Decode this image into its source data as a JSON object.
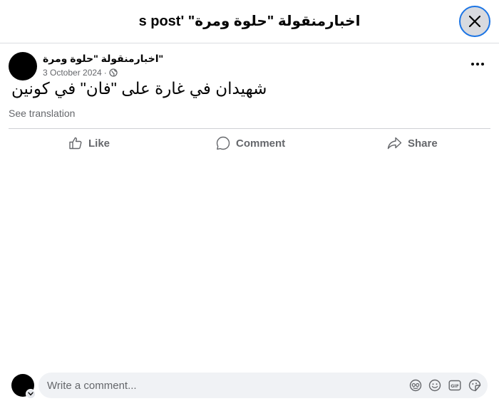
{
  "header": {
    "title": "اخبارمنقولة \"حلوة ومرة\" 's post",
    "close_icon": "close-icon"
  },
  "post": {
    "author": "\"اخبارمنقولة \"حلوة ومرة",
    "date": "3 October 2024",
    "separator": "·",
    "privacy_icon": "globe-icon",
    "more_icon": "more-options-icon",
    "text": "شهيدان في غارة على \"فان\" في كونين",
    "see_translation": "See translation"
  },
  "actions": {
    "like_label": "Like",
    "comment_label": "Comment",
    "share_label": "Share"
  },
  "composer": {
    "placeholder": "Write a comment...",
    "icons": [
      "avatar-sticker-icon",
      "emoji-icon",
      "gif-icon",
      "sticker-icon"
    ]
  },
  "colors": {
    "accent_focus": "#1b74e4",
    "secondary_text": "#65676b",
    "input_background": "#f0f2f5"
  }
}
